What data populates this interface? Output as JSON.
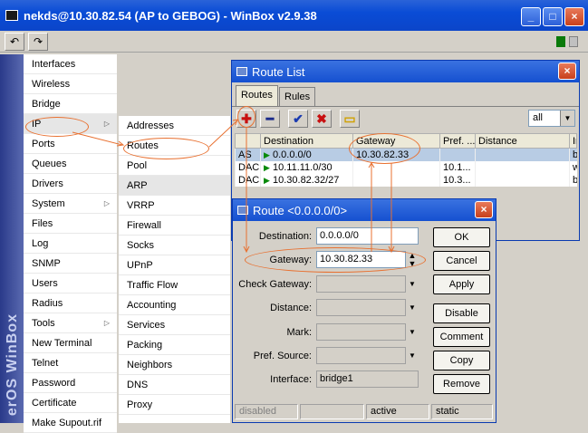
{
  "app": {
    "title": "nekds@10.30.82.54 (AP to GEBOG) - WinBox v2.9.38",
    "branding": "erOS WinBox"
  },
  "window_controls": {
    "minimize": "_",
    "maximize": "□",
    "close": "×"
  },
  "toolbar": {
    "undo": "↶",
    "redo": "↷"
  },
  "main_menu": [
    {
      "label": "Interfaces"
    },
    {
      "label": "Wireless"
    },
    {
      "label": "Bridge"
    },
    {
      "label": "IP",
      "submenu": true
    },
    {
      "label": "Ports"
    },
    {
      "label": "Queues"
    },
    {
      "label": "Drivers"
    },
    {
      "label": "System",
      "submenu": true
    },
    {
      "label": "Files"
    },
    {
      "label": "Log"
    },
    {
      "label": "SNMP"
    },
    {
      "label": "Users"
    },
    {
      "label": "Radius"
    },
    {
      "label": "Tools",
      "submenu": true
    },
    {
      "label": "New Terminal"
    },
    {
      "label": "Telnet"
    },
    {
      "label": "Password"
    },
    {
      "label": "Certificate"
    },
    {
      "label": "Make Supout.rif"
    }
  ],
  "ip_submenu": [
    {
      "label": "Addresses"
    },
    {
      "label": "Routes"
    },
    {
      "label": "Pool"
    },
    {
      "label": "ARP"
    },
    {
      "label": "VRRP"
    },
    {
      "label": "Firewall"
    },
    {
      "label": "Socks"
    },
    {
      "label": "UPnP"
    },
    {
      "label": "Traffic Flow"
    },
    {
      "label": "Accounting"
    },
    {
      "label": "Services"
    },
    {
      "label": "Packing"
    },
    {
      "label": "Neighbors"
    },
    {
      "label": "DNS"
    },
    {
      "label": "Proxy"
    }
  ],
  "route_list": {
    "title": "Route List",
    "tabs": [
      "Routes",
      "Rules"
    ],
    "filter": "all",
    "columns": [
      "",
      "Destination",
      "Gateway",
      "Pref. ...",
      "Distance",
      "In"
    ],
    "rows": [
      {
        "flags": "AS",
        "destination": "0.0.0.0/0",
        "gateway": "10.30.82.33",
        "pref": "",
        "distance": "",
        "in": "b"
      },
      {
        "flags": "DAC",
        "destination": "10.11.11.0/30",
        "gateway": "",
        "pref": "10.1...",
        "distance": "",
        "in": "w"
      },
      {
        "flags": "DAC",
        "destination": "10.30.82.32/27",
        "gateway": "",
        "pref": "10.3...",
        "distance": "",
        "in": "b"
      }
    ]
  },
  "route_dialog": {
    "title": "Route <0.0.0.0/0>",
    "labels": {
      "destination": "Destination:",
      "gateway": "Gateway:",
      "check_gateway": "Check Gateway:",
      "distance": "Distance:",
      "mark": "Mark:",
      "pref_source": "Pref. Source:",
      "interface": "Interface:"
    },
    "values": {
      "destination": "0.0.0.0/0",
      "gateway": "10.30.82.33",
      "interface": "bridge1"
    },
    "buttons": [
      "OK",
      "Cancel",
      "Apply",
      "Disable",
      "Comment",
      "Copy",
      "Remove"
    ],
    "status": [
      "disabled",
      "",
      "active",
      "static"
    ]
  },
  "colors": {
    "annotation": "#e87030",
    "titlebar": "#0a4cd6",
    "selected_row": "#b8cce4"
  }
}
